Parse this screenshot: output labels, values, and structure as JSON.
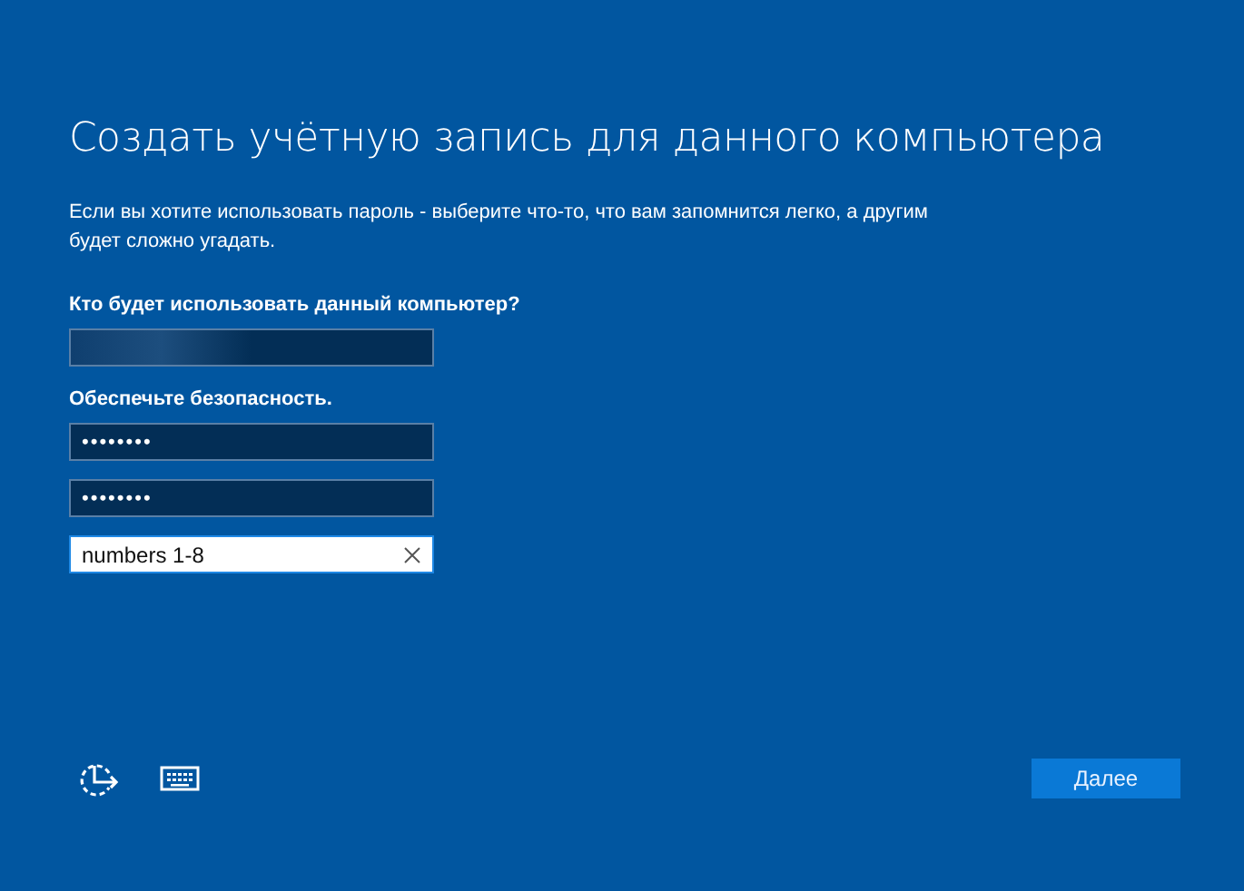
{
  "title": "Создать учётную запись для данного компьютера",
  "intro": "Если вы хотите использовать пароль - выберите что-то, что вам запомнится легко, а другим будет сложно угадать.",
  "sections": [
    {
      "label": "Кто будет использовать данный компьютер?",
      "fields": [
        {
          "kind": "blurred"
        }
      ]
    },
    {
      "label": "Обеспечьте безопасность.",
      "fields": [
        {
          "kind": "password",
          "value": "••••••••"
        },
        {
          "kind": "password",
          "value": "••••••••"
        },
        {
          "kind": "hint",
          "value": "numbers 1-8",
          "focused": true
        }
      ]
    }
  ],
  "next_button": "Далее"
}
